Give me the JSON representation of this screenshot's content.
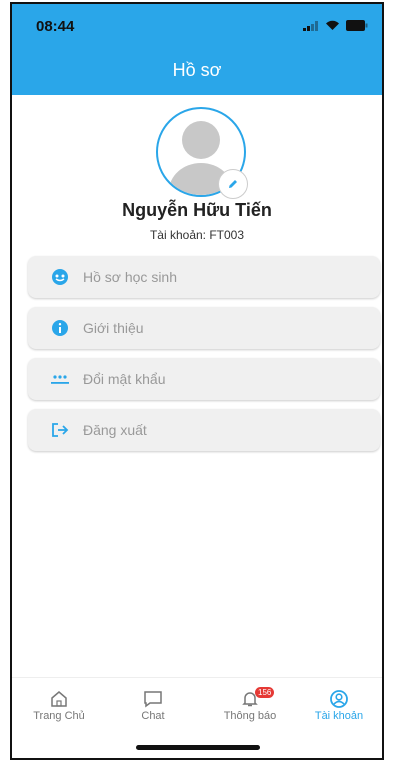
{
  "status": {
    "time": "08:44"
  },
  "header": {
    "title": "Hồ sơ"
  },
  "profile": {
    "name": "Nguyễn Hữu Tiến",
    "account": "Tài khoản: FT003"
  },
  "menu": [
    {
      "label": "Hồ sơ học sinh",
      "icon": "student-profile-icon"
    },
    {
      "label": "Giới thiệu",
      "icon": "info-icon"
    },
    {
      "label": "Đổi mật khẩu",
      "icon": "password-icon"
    },
    {
      "label": "Đăng xuất",
      "icon": "logout-icon"
    }
  ],
  "tabs": [
    {
      "label": "Trang Chủ",
      "icon": "home-icon"
    },
    {
      "label": "Chat",
      "icon": "chat-icon"
    },
    {
      "label": "Thông báo",
      "icon": "bell-icon",
      "badge": "156"
    },
    {
      "label": "Tài khoản",
      "icon": "account-icon",
      "active": true
    }
  ],
  "colors": {
    "accent": "#2aa6e9",
    "menu_bg": "#f0f0f0",
    "badge": "#e53935"
  }
}
